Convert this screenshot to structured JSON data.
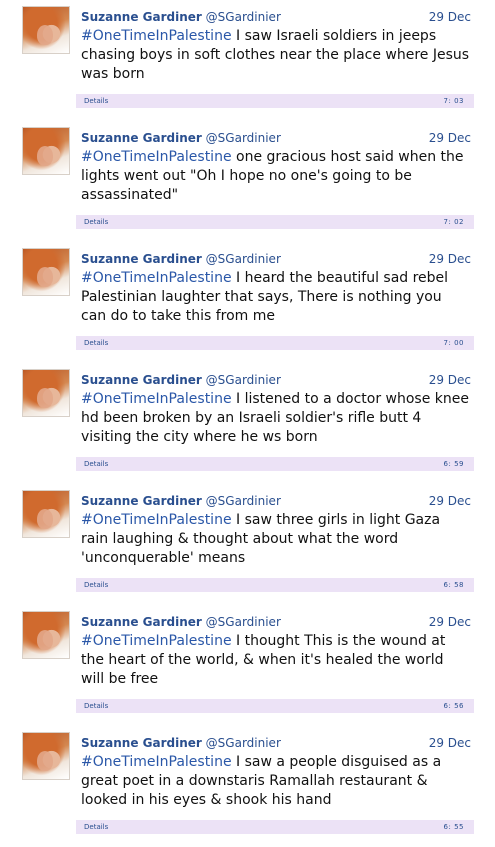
{
  "details_label": "Details",
  "tweets": [
    {
      "name": "Suzanne Gardiner",
      "handle": "@SGardinier",
      "date": "29 Dec",
      "hashtag": "#OneTimeInPalestine",
      "text": " I saw Israeli soldiers in jeeps chasing boys in soft clothes near the place where Jesus was born",
      "time": "7: 03"
    },
    {
      "name": "Suzanne Gardiner",
      "handle": "@SGardinier",
      "date": "29 Dec",
      "hashtag": "#OneTimeInPalestine",
      "text": " one gracious host said when the lights went out \"Oh I hope no one's going to be assassinated\"",
      "time": "7: 02"
    },
    {
      "name": "Suzanne Gardiner",
      "handle": "@SGardinier",
      "date": "29 Dec",
      "hashtag": "#OneTimeInPalestine",
      "text": " I heard the beautiful sad rebel Palestinian laughter that says, There is nothing you can do to take this from me",
      "time": "7: 00"
    },
    {
      "name": "Suzanne Gardiner",
      "handle": "@SGardinier",
      "date": "29 Dec",
      "hashtag": "#OneTimeInPalestine",
      "text": " I listened to a doctor whose knee hd been broken by an Israeli soldier's rifle butt 4 visiting the city where he ws born",
      "time": "6: 59"
    },
    {
      "name": "Suzanne Gardiner",
      "handle": "@SGardinier",
      "date": "29 Dec",
      "hashtag": "#OneTimeInPalestine",
      "text": " I saw three girls in light Gaza rain laughing & thought about what the word 'unconquerable' means",
      "time": "6: 58"
    },
    {
      "name": "Suzanne Gardiner",
      "handle": "@SGardinier",
      "date": "29 Dec",
      "hashtag": "#OneTimeInPalestine",
      "text": " I thought This is the wound at the heart of the world, & when it's healed the world will be free",
      "time": "6: 56"
    },
    {
      "name": "Suzanne Gardiner",
      "handle": "@SGardinier",
      "date": "29 Dec",
      "hashtag": "#OneTimeInPalestine",
      "text": " I saw a people disguised as a great poet in a downstaris Ramallah restaurant & looked in his eyes & shook his hand",
      "time": "6: 55"
    }
  ]
}
